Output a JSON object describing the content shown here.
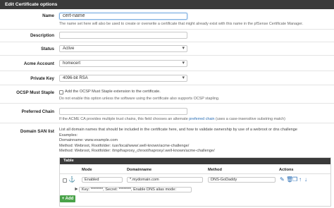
{
  "panel": {
    "title": "Edit Certificate options"
  },
  "name": {
    "label": "Name",
    "value": "cert-name",
    "help": "The name set here will also be used to create or overwrite a certificate that might already exist with this name in the pfSense Certificate Manager."
  },
  "description": {
    "label": "Description",
    "value": ""
  },
  "status": {
    "label": "Status",
    "value": "Active"
  },
  "acme_account": {
    "label": "Acme Account",
    "value": "homecert"
  },
  "private_key": {
    "label": "Private Key",
    "value": "4096-bit RSA"
  },
  "ocsp": {
    "label": "OCSP Must Staple",
    "checkbox_label": "Add the OCSP Must Staple extension to the certificate.",
    "help": "Do not enable this option unless the software using the certificate also supports OCSP stapling."
  },
  "preferred_chain": {
    "label": "Preferred Chain",
    "value": "",
    "help_before": "If the ACME CA provides multiple trust chains, this field chooses an alternate",
    "help_link": "preferred chain",
    "help_after": "(uses a case-insensitive substring match)"
  },
  "san": {
    "label": "Domain SAN list",
    "description_lines": [
      "List all domain names that should be included in the certificate here, and how to validate ownership by use of a webroot or dns challenge",
      "Examples:",
      "Domainname: www.example.com",
      "Method: Webroot, Rootfolder: /usr/local/www/.well-known/acme-challenge/",
      "Method: Webroot, Rootfolder: /tmp/haproxy_chroot/haproxy/.well-known/acme-challenge/"
    ],
    "table_title": "Table",
    "columns": [
      "Mode",
      "Domainname",
      "Method",
      "Actions"
    ],
    "row": {
      "mode": "Enabled",
      "domainname": "*.mydomain.com",
      "method": "DNS-GoDaddy"
    },
    "detail": "Key: ********, Secret: ********, Enable DNS alias mode:",
    "add_button": "+ Add"
  },
  "colors": {
    "heading": "#3a3a3a",
    "link": "#2a6eb5",
    "add": "#4aa34a"
  },
  "icons": [
    "anchor-icon",
    "edit-icon",
    "delete-icon",
    "copy-icon",
    "arrow-up-icon",
    "arrow-down-icon",
    "checkbox-icon"
  ]
}
